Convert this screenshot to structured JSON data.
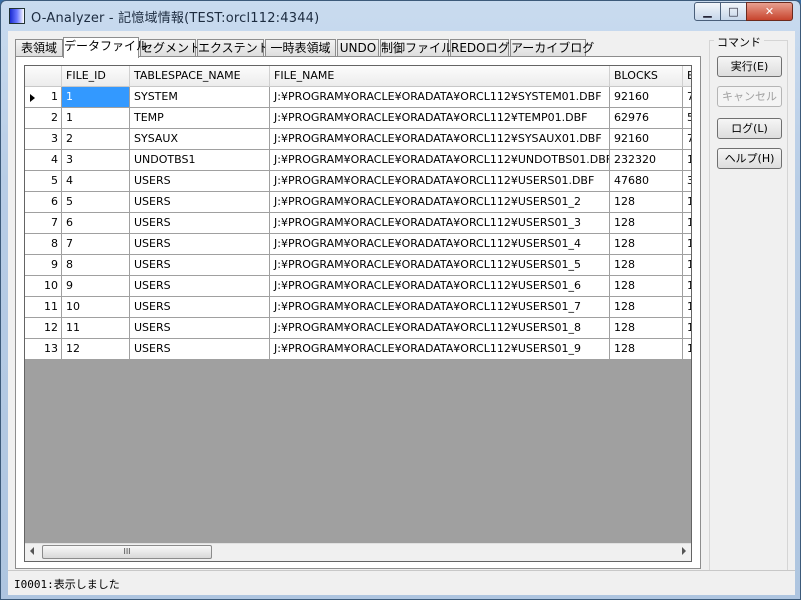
{
  "window": {
    "title": "O-Analyzer - 記憶域情報(TEST:orcl112:4344)",
    "controls": {
      "minimize": "▁",
      "maximize": "□",
      "close": "✕"
    }
  },
  "tabs": [
    {
      "label": "表領域",
      "active": false
    },
    {
      "label": "データファイル",
      "active": true
    },
    {
      "label": "セグメント",
      "active": false
    },
    {
      "label": "エクステント",
      "active": false
    },
    {
      "label": "一時表領域",
      "active": false
    },
    {
      "label": "UNDO",
      "active": false
    },
    {
      "label": "制御ファイル",
      "active": false
    },
    {
      "label": "REDOログ",
      "active": false
    },
    {
      "label": "アーカイブログ",
      "active": false
    }
  ],
  "grid": {
    "columns": [
      "FILE_ID",
      "TABLESPACE_NAME",
      "FILE_NAME",
      "BLOCKS",
      "B"
    ],
    "rows": [
      {
        "num": "1",
        "cells": [
          "1",
          "SYSTEM",
          "J:¥PROGRAM¥ORACLE¥ORADATA¥ORCL112¥SYSTEM01.DBF",
          "92160",
          "7"
        ]
      },
      {
        "num": "2",
        "cells": [
          "1",
          "TEMP",
          "J:¥PROGRAM¥ORACLE¥ORADATA¥ORCL112¥TEMP01.DBF",
          "62976",
          "5"
        ]
      },
      {
        "num": "3",
        "cells": [
          "2",
          "SYSAUX",
          "J:¥PROGRAM¥ORACLE¥ORADATA¥ORCL112¥SYSAUX01.DBF",
          "92160",
          "7"
        ]
      },
      {
        "num": "4",
        "cells": [
          "3",
          "UNDOTBS1",
          "J:¥PROGRAM¥ORACLE¥ORADATA¥ORCL112¥UNDOTBS01.DBF",
          "232320",
          "1"
        ]
      },
      {
        "num": "5",
        "cells": [
          "4",
          "USERS",
          "J:¥PROGRAM¥ORACLE¥ORADATA¥ORCL112¥USERS01.DBF",
          "47680",
          "3"
        ]
      },
      {
        "num": "6",
        "cells": [
          "5",
          "USERS",
          "J:¥PROGRAM¥ORACLE¥ORADATA¥ORCL112¥USERS01_2",
          "128",
          "1"
        ]
      },
      {
        "num": "7",
        "cells": [
          "6",
          "USERS",
          "J:¥PROGRAM¥ORACLE¥ORADATA¥ORCL112¥USERS01_3",
          "128",
          "1"
        ]
      },
      {
        "num": "8",
        "cells": [
          "7",
          "USERS",
          "J:¥PROGRAM¥ORACLE¥ORADATA¥ORCL112¥USERS01_4",
          "128",
          "1"
        ]
      },
      {
        "num": "9",
        "cells": [
          "8",
          "USERS",
          "J:¥PROGRAM¥ORACLE¥ORADATA¥ORCL112¥USERS01_5",
          "128",
          "1"
        ]
      },
      {
        "num": "10",
        "cells": [
          "9",
          "USERS",
          "J:¥PROGRAM¥ORACLE¥ORADATA¥ORCL112¥USERS01_6",
          "128",
          "1"
        ]
      },
      {
        "num": "11",
        "cells": [
          "10",
          "USERS",
          "J:¥PROGRAM¥ORACLE¥ORADATA¥ORCL112¥USERS01_7",
          "128",
          "1"
        ]
      },
      {
        "num": "12",
        "cells": [
          "11",
          "USERS",
          "J:¥PROGRAM¥ORACLE¥ORADATA¥ORCL112¥USERS01_8",
          "128",
          "1"
        ]
      },
      {
        "num": "13",
        "cells": [
          "12",
          "USERS",
          "J:¥PROGRAM¥ORACLE¥ORADATA¥ORCL112¥USERS01_9",
          "128",
          "1"
        ]
      }
    ],
    "scroll_thumb_label": "III"
  },
  "commands": {
    "legend": "コマンド",
    "buttons": [
      {
        "label": "実行(E)",
        "enabled": true
      },
      {
        "label": "キャンセル",
        "enabled": false
      },
      {
        "label": "ログ(L)",
        "enabled": true
      },
      {
        "label": "ヘルプ(H)",
        "enabled": true
      }
    ]
  },
  "status": {
    "text": "I0001:表示しました"
  }
}
